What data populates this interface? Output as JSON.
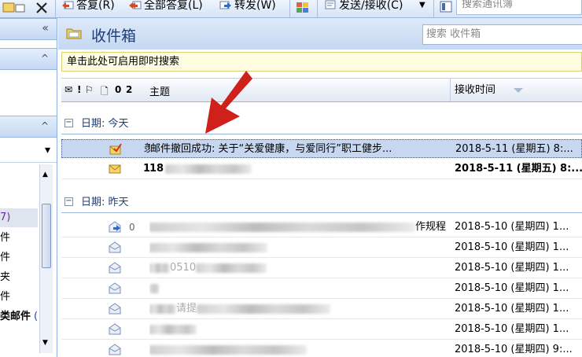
{
  "toolbar": {
    "reply": "答复(R)",
    "reply_all": "全部答复(L)",
    "forward": "转发(W)",
    "send_receive": "发送/接收(C)",
    "address_book_placeholder": "搜索通讯簿"
  },
  "nav": {
    "collapse_label": "«",
    "section_toggle": "^",
    "dropdown_caret": "▾",
    "folders": [
      "7)",
      "件",
      "件",
      "夹",
      "件",
      "类邮件"
    ],
    "folder_count": "(:"
  },
  "inbox": {
    "title": "收件箱",
    "search_placeholder": "搜索 收件箱",
    "instant_search_hint": "单击此处可启用即时搜索",
    "columns": {
      "subject": "主题",
      "received": "接收时间"
    },
    "column_icons": [
      "✉",
      "!",
      "⚐",
      "🗋",
      "0",
      "2"
    ],
    "groups": [
      {
        "label": "日期: 今天",
        "collapse_symbol": "−",
        "messages": [
          {
            "from_initial": "羡",
            "subject": "邮件撤回成功: 关于“关爱健康，与爱同行”职工健步...",
            "received": "2018-5-11 (星期五) 8:...",
            "selected": true,
            "unread": false,
            "icon": "recall-success-icon"
          },
          {
            "from_initial": "1",
            "subject": "18",
            "received": "2018-5-11 (星期五) 8:...",
            "selected": false,
            "unread": true,
            "icon": "envelope-unread-icon"
          }
        ]
      },
      {
        "label": "日期: 昨天",
        "collapse_symbol": "−",
        "messages": [
          {
            "from_initial": "",
            "subject": "作规程...",
            "received": "2018-5-10 (星期四) 1...",
            "icon": "forwarded-icon",
            "attachment": true
          },
          {
            "from_initial": "",
            "subject": "",
            "received": "2018-5-10 (星期四) 1...",
            "icon": "envelope-open-icon"
          },
          {
            "from_initial": "",
            "subject": "0510",
            "received": "2018-5-10 (星期四) 1...",
            "icon": "envelope-open-icon"
          },
          {
            "from_initial": "",
            "subject": "",
            "received": "2018-5-10 (星期四) 1...",
            "icon": "envelope-open-icon"
          },
          {
            "from_initial": "",
            "subject": "请提",
            "received": "2018-5-10 (星期四) 1...",
            "icon": "envelope-open-icon"
          },
          {
            "from_initial": "",
            "subject": "",
            "received": "2018-5-10 (星期四) 1...",
            "icon": "envelope-open-icon"
          },
          {
            "from_initial": "",
            "subject": "",
            "received": "2018-5-10 (星期四) 9:...",
            "icon": "envelope-open-icon"
          }
        ]
      }
    ]
  }
}
